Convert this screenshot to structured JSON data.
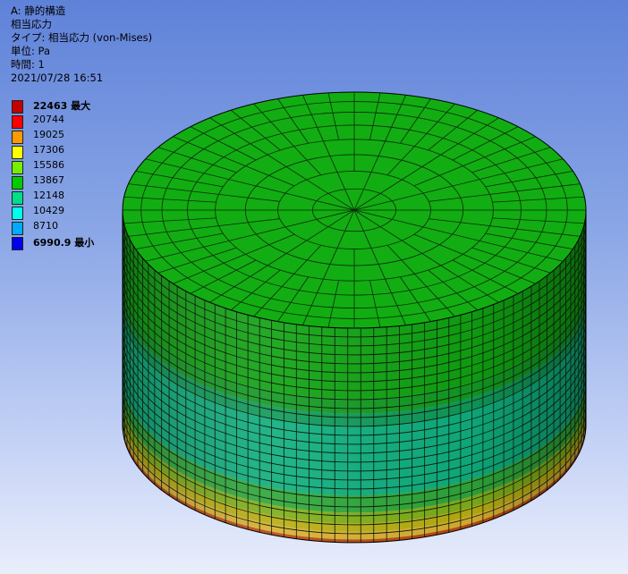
{
  "header": {
    "analysis": "A: 静的構造",
    "result": "相当応力",
    "type": "タイプ: 相当応力 (von-Mises)",
    "unit": "単位: Pa",
    "time": "時間: 1",
    "date": "2021/07/28 16:51"
  },
  "legend": {
    "items": [
      {
        "label": "22463 最大",
        "color": "#c40000",
        "bold": true
      },
      {
        "label": "20744",
        "color": "#ff0000",
        "bold": false
      },
      {
        "label": "19025",
        "color": "#ff9900",
        "bold": false
      },
      {
        "label": "17306",
        "color": "#ffff00",
        "bold": false
      },
      {
        "label": "15586",
        "color": "#77ee00",
        "bold": false
      },
      {
        "label": "13867",
        "color": "#00cc00",
        "bold": false
      },
      {
        "label": "12148",
        "color": "#00dd88",
        "bold": false
      },
      {
        "label": "10429",
        "color": "#00ffee",
        "bold": false
      },
      {
        "label": "8710",
        "color": "#00aaff",
        "bold": false
      },
      {
        "label": "6990.9 最小",
        "color": "#0000ee",
        "bold": true
      }
    ]
  },
  "model": {
    "top_color": "#12ad12",
    "band_colors": [
      "#10a212",
      "#139a22",
      "#109a5a",
      "#0fae7e",
      "#2fa63a",
      "#7fae1a",
      "#b8ae12",
      "#d8b030",
      "#b84a10"
    ]
  }
}
